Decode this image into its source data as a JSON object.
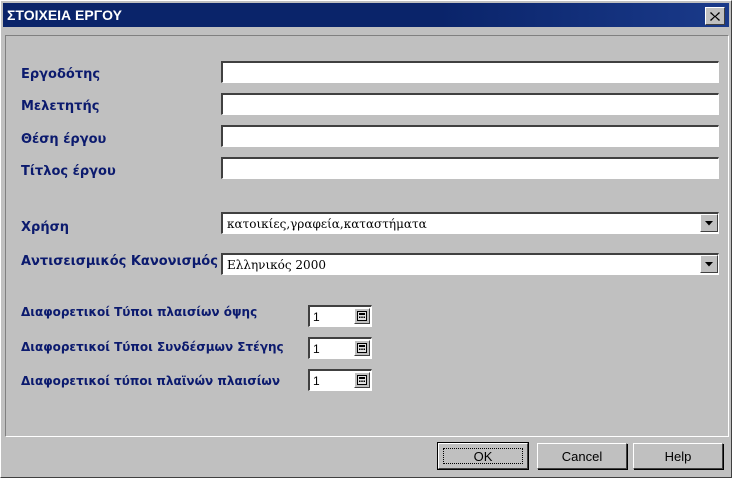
{
  "window": {
    "title": "ΣΤΟΙΧΕΙΑ ΕΡΓΟΥ",
    "close_label": "close"
  },
  "fields": {
    "employer_label": "Εργοδότης",
    "employer_value": "",
    "designer_label": "Μελετητής",
    "designer_value": "",
    "location_label": "Θέση έργου",
    "location_value": "",
    "title_label": "Τίτλος έργου",
    "title_value": ""
  },
  "usage": {
    "label": "Χρήση",
    "value": "κατοικίες,γραφεία,καταστήματα"
  },
  "code": {
    "label": "Αντισεισμικός Κανονισμός",
    "value": "Ελληνικός 2000"
  },
  "types": {
    "frames_label": "Διαφορετικοί Τύποι πλαισίων όψης",
    "frames_value": "1",
    "roof_label": "Διαφορετικοί Τύποι Συνδέσμων Στέγης",
    "roof_value": "1",
    "side_label": "Διαφορετικοί τύποι πλαϊνών πλαισίων",
    "side_value": "1"
  },
  "buttons": {
    "ok": "OK",
    "cancel": "Cancel",
    "help": "Help"
  },
  "icons": {
    "close": "close-icon",
    "dropdown": "chevron-down-icon",
    "spin": "calculator-icon"
  }
}
